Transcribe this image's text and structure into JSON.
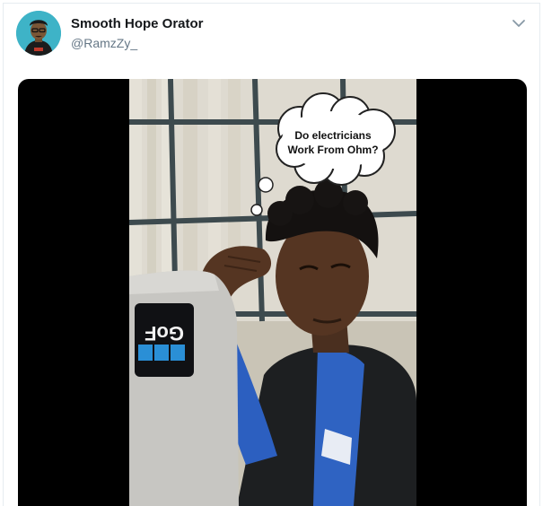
{
  "tweet": {
    "display_name": "Smooth Hope Orator",
    "handle": "@RamzZy_",
    "avatar_icon": "avatar-illustration",
    "menu_icon": "chevron-down-icon"
  },
  "media": {
    "caption_line1": "Do electricians",
    "caption_line2": "Work From Ohm?",
    "laptop_logo": "GoF"
  },
  "colors": {
    "name": "#14171a",
    "handle": "#657786",
    "chevron": "#8899a6",
    "avatar_bg": "#3eb3c7"
  }
}
